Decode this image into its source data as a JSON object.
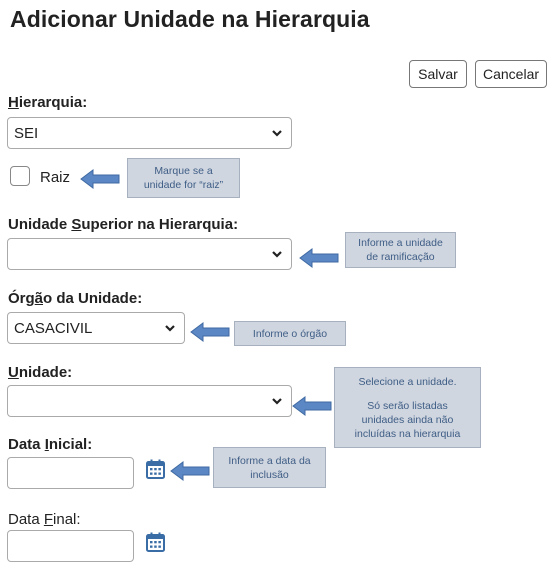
{
  "page": {
    "title": "Adicionar Unidade na Hierarquia"
  },
  "toolbar": {
    "save_label": "Salvar",
    "cancel_label": "Cancelar"
  },
  "form": {
    "hierarquia": {
      "label_u": "H",
      "label_rest": "ierarquia:",
      "value": "SEI"
    },
    "raiz": {
      "label": "Raiz",
      "checked": false
    },
    "unidade_superior": {
      "label_a": "Unidade ",
      "label_u": "S",
      "label_b": "uperior na Hierarquia:",
      "value": ""
    },
    "orgao": {
      "label_a": "Órg",
      "label_u": "ã",
      "label_b": "o da Unidade:",
      "value": "CASACIVIL"
    },
    "unidade": {
      "label_u": "U",
      "label_rest": "nidade:",
      "value": ""
    },
    "data_inicial": {
      "label_a": "Data ",
      "label_u": "I",
      "label_b": "nicial:",
      "value": ""
    },
    "data_final": {
      "label_a": "Data ",
      "label_u": "F",
      "label_b": "inal:",
      "value": ""
    }
  },
  "callouts": {
    "raiz": [
      "Marque se a",
      "unidade for “raiz”"
    ],
    "unidade_superior": [
      "Informe a unidade",
      "de ramificação"
    ],
    "orgao": [
      "Informe o órgão"
    ],
    "unidade": [
      "Selecione a unidade.",
      "",
      "Só serão listadas",
      "unidades ainda não",
      "incluídas na hierarquia"
    ],
    "data_inicial": [
      "Informe a data da",
      "inclusão"
    ]
  },
  "colors": {
    "callout_bg": "#d0d6e0",
    "arrow_fill": "#5b87c4",
    "icon_blue": "#3a6da6"
  },
  "icons": {
    "chevron": "chevron-down-icon",
    "calendar": "calendar-icon",
    "arrow": "arrow-left-icon"
  }
}
